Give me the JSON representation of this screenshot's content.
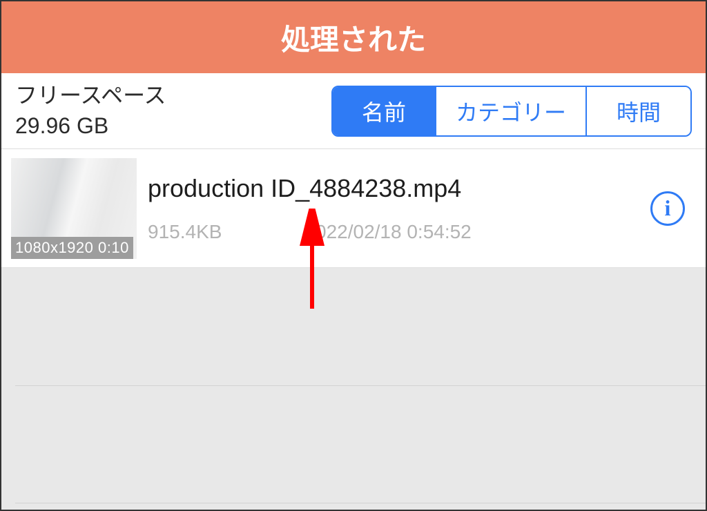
{
  "header": {
    "title": "処理された"
  },
  "toolbar": {
    "free_space_label": "フリースペース",
    "free_space_value": "29.96 GB",
    "segments": [
      {
        "label": "名前",
        "active": true
      },
      {
        "label": "カテゴリー",
        "active": false
      },
      {
        "label": "時間",
        "active": false
      }
    ]
  },
  "list": {
    "items": [
      {
        "name": "production ID_4884238.mp4",
        "size": "915.4KB",
        "date": "2022/02/18 0:54:52",
        "thumb_resolution": "1080x1920",
        "thumb_duration": "0:10"
      }
    ]
  },
  "icons": {
    "info": "i"
  }
}
